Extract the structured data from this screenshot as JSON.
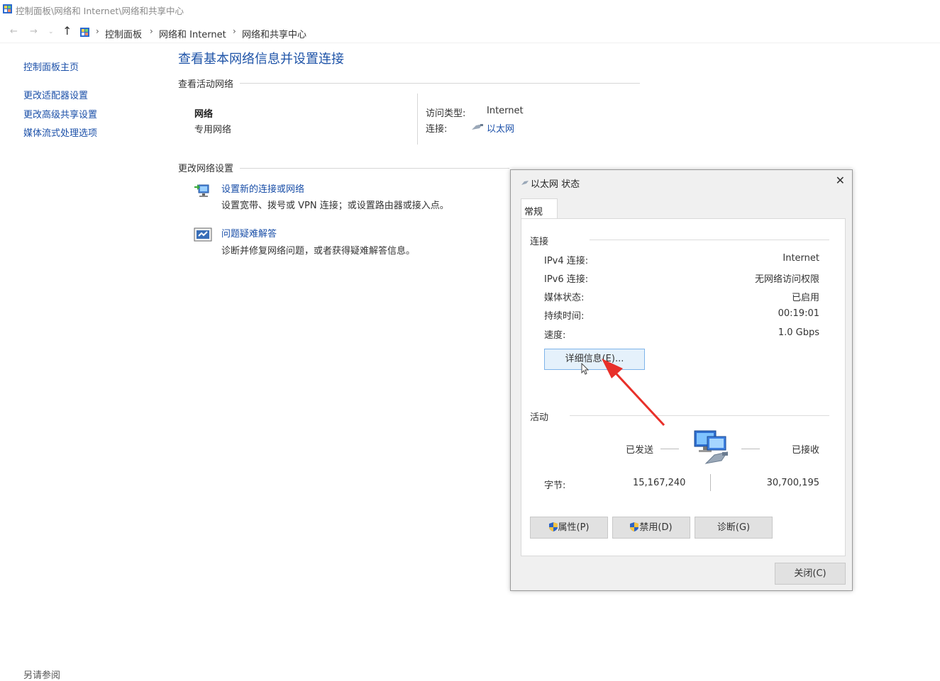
{
  "window": {
    "title": "控制面板\\网络和 Internet\\网络和共享中心"
  },
  "address_bar": {
    "back_icon": "back-arrow-icon",
    "forward_icon": "forward-arrow-icon",
    "up_icon": "up-arrow-icon",
    "crumbs": [
      "控制面板",
      "网络和 Internet",
      "网络和共享中心"
    ],
    "separator": "›"
  },
  "sidebar": {
    "items": [
      {
        "label": "控制面板主页"
      },
      {
        "label": "更改适配器设置"
      },
      {
        "label": "更改高级共享设置"
      },
      {
        "label": "媒体流式处理选项"
      }
    ],
    "see_also": "另请参阅"
  },
  "main": {
    "title": "查看基本网络信息并设置连接",
    "active_networks_heading": "查看活动网络",
    "network_name": "网络",
    "network_type": "专用网络",
    "access_type_label": "访问类型:",
    "access_type_value": "Internet",
    "connection_label": "连接:",
    "connection_value": "以太网",
    "change_settings_heading": "更改网络设置",
    "tasks": [
      {
        "title": "设置新的连接或网络",
        "desc": "设置宽带、拨号或 VPN 连接；或设置路由器或接入点。"
      },
      {
        "title": "问题疑难解答",
        "desc": "诊断并修复网络问题，或者获得疑难解答信息。"
      }
    ]
  },
  "dialog": {
    "title": "以太网 状态",
    "tab": "常规",
    "connection_heading": "连接",
    "rows": [
      {
        "label": "IPv4 连接:",
        "value": "Internet"
      },
      {
        "label": "IPv6 连接:",
        "value": "无网络访问权限"
      },
      {
        "label": "媒体状态:",
        "value": "已启用"
      },
      {
        "label": "持续时间:",
        "value": "00:19:01"
      },
      {
        "label": "速度:",
        "value": "1.0 Gbps"
      }
    ],
    "details_button": "详细信息(E)...",
    "activity_heading": "活动",
    "sent_label": "已发送",
    "received_label": "已接收",
    "bytes_label": "字节:",
    "bytes_sent": "15,167,240",
    "bytes_received": "30,700,195",
    "properties_button": "属性(P)",
    "disable_button": "禁用(D)",
    "diagnose_button": "诊断(G)",
    "close_button": "关闭(C)"
  },
  "colors": {
    "link": "#1a4fa8",
    "title": "#1f54a8",
    "annotation_arrow": "#e8302a"
  }
}
